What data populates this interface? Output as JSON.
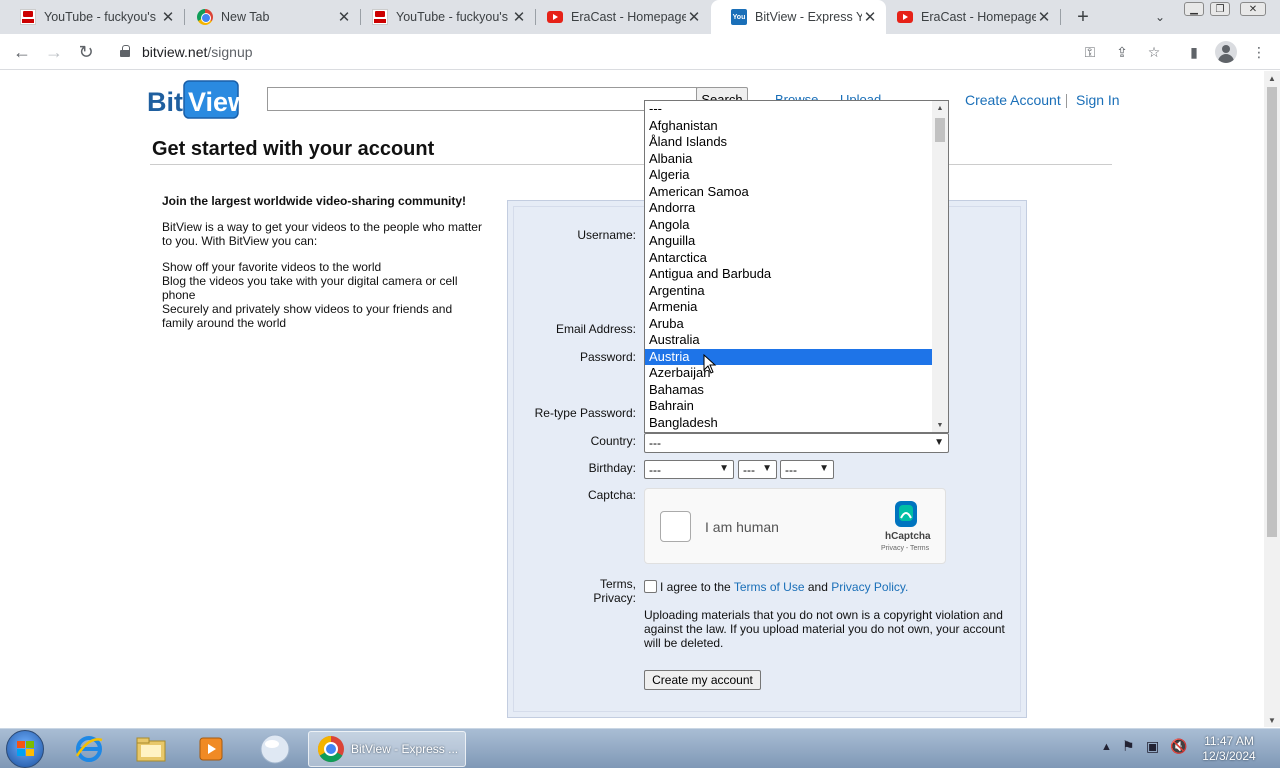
{
  "browser": {
    "tabs": [
      {
        "title": "YouTube - fuckyou's",
        "favicon": "youtube-icon"
      },
      {
        "title": "New Tab",
        "favicon": "chrome-icon"
      },
      {
        "title": "YouTube - fuckyou's",
        "favicon": "youtube-icon"
      },
      {
        "title": "EraCast - Homepage",
        "favicon": "eracast-icon"
      },
      {
        "title": "BitView - Express Yo",
        "favicon": "bitview-icon"
      },
      {
        "title": "EraCast - Homepage",
        "favicon": "eracast-icon"
      }
    ],
    "active_tab_index": 4,
    "url_host": "bitview.net",
    "url_path": "/signup"
  },
  "site": {
    "logo_text": "BitView",
    "search_button": "Search",
    "nav": [
      "Browse",
      "Upload"
    ],
    "create_account": "Create Account",
    "sign_in": "Sign In"
  },
  "page": {
    "heading": "Get started with your account",
    "intro_bold": "Join the largest worldwide video-sharing community!",
    "intro_text": "BitView is a way to get your videos to the people who matter to you. With BitView you can:",
    "bullets": [
      "Show off your favorite videos to the world",
      "Blog the videos you take with your digital camera or cell phone",
      "Securely and privately show videos to your friends and family around the world"
    ]
  },
  "form": {
    "labels": {
      "username": "Username:",
      "email": "Email Address:",
      "password": "Password:",
      "retype": "Re-type Password:",
      "country": "Country:",
      "birthday": "Birthday:",
      "captcha": "Captcha:",
      "terms_line1": "Terms,",
      "terms_line2": "Privacy:"
    },
    "country_value": "---",
    "birthday_values": [
      "---",
      "---",
      "---"
    ],
    "captcha": {
      "label": "I am human",
      "brand": "hCaptcha",
      "sub": "Privacy - Terms"
    },
    "agree_prefix": "I agree to the",
    "terms_link": "Terms of Use",
    "agree_and": "and",
    "privacy_link": "Privacy Policy.",
    "warning": "Uploading materials that you do not own is a copyright violation and against the law. If you upload material you do not own, your account will be deleted.",
    "submit": "Create my account"
  },
  "country_dropdown": {
    "options": [
      "---",
      "Afghanistan",
      "Åland Islands",
      "Albania",
      "Algeria",
      "American Samoa",
      "Andorra",
      "Angola",
      "Anguilla",
      "Antarctica",
      "Antigua and Barbuda",
      "Argentina",
      "Armenia",
      "Aruba",
      "Australia",
      "Austria",
      "Azerbaijan",
      "Bahamas",
      "Bahrain",
      "Bangladesh"
    ],
    "highlighted": "Austria"
  },
  "taskbar": {
    "active_app": "BitView - Express ...",
    "time": "11:47 AM",
    "date": "12/3/2024"
  },
  "colors": {
    "link": "#1a6fb8",
    "highlight": "#1e74e8",
    "form_bg": "#e6ecf6"
  }
}
